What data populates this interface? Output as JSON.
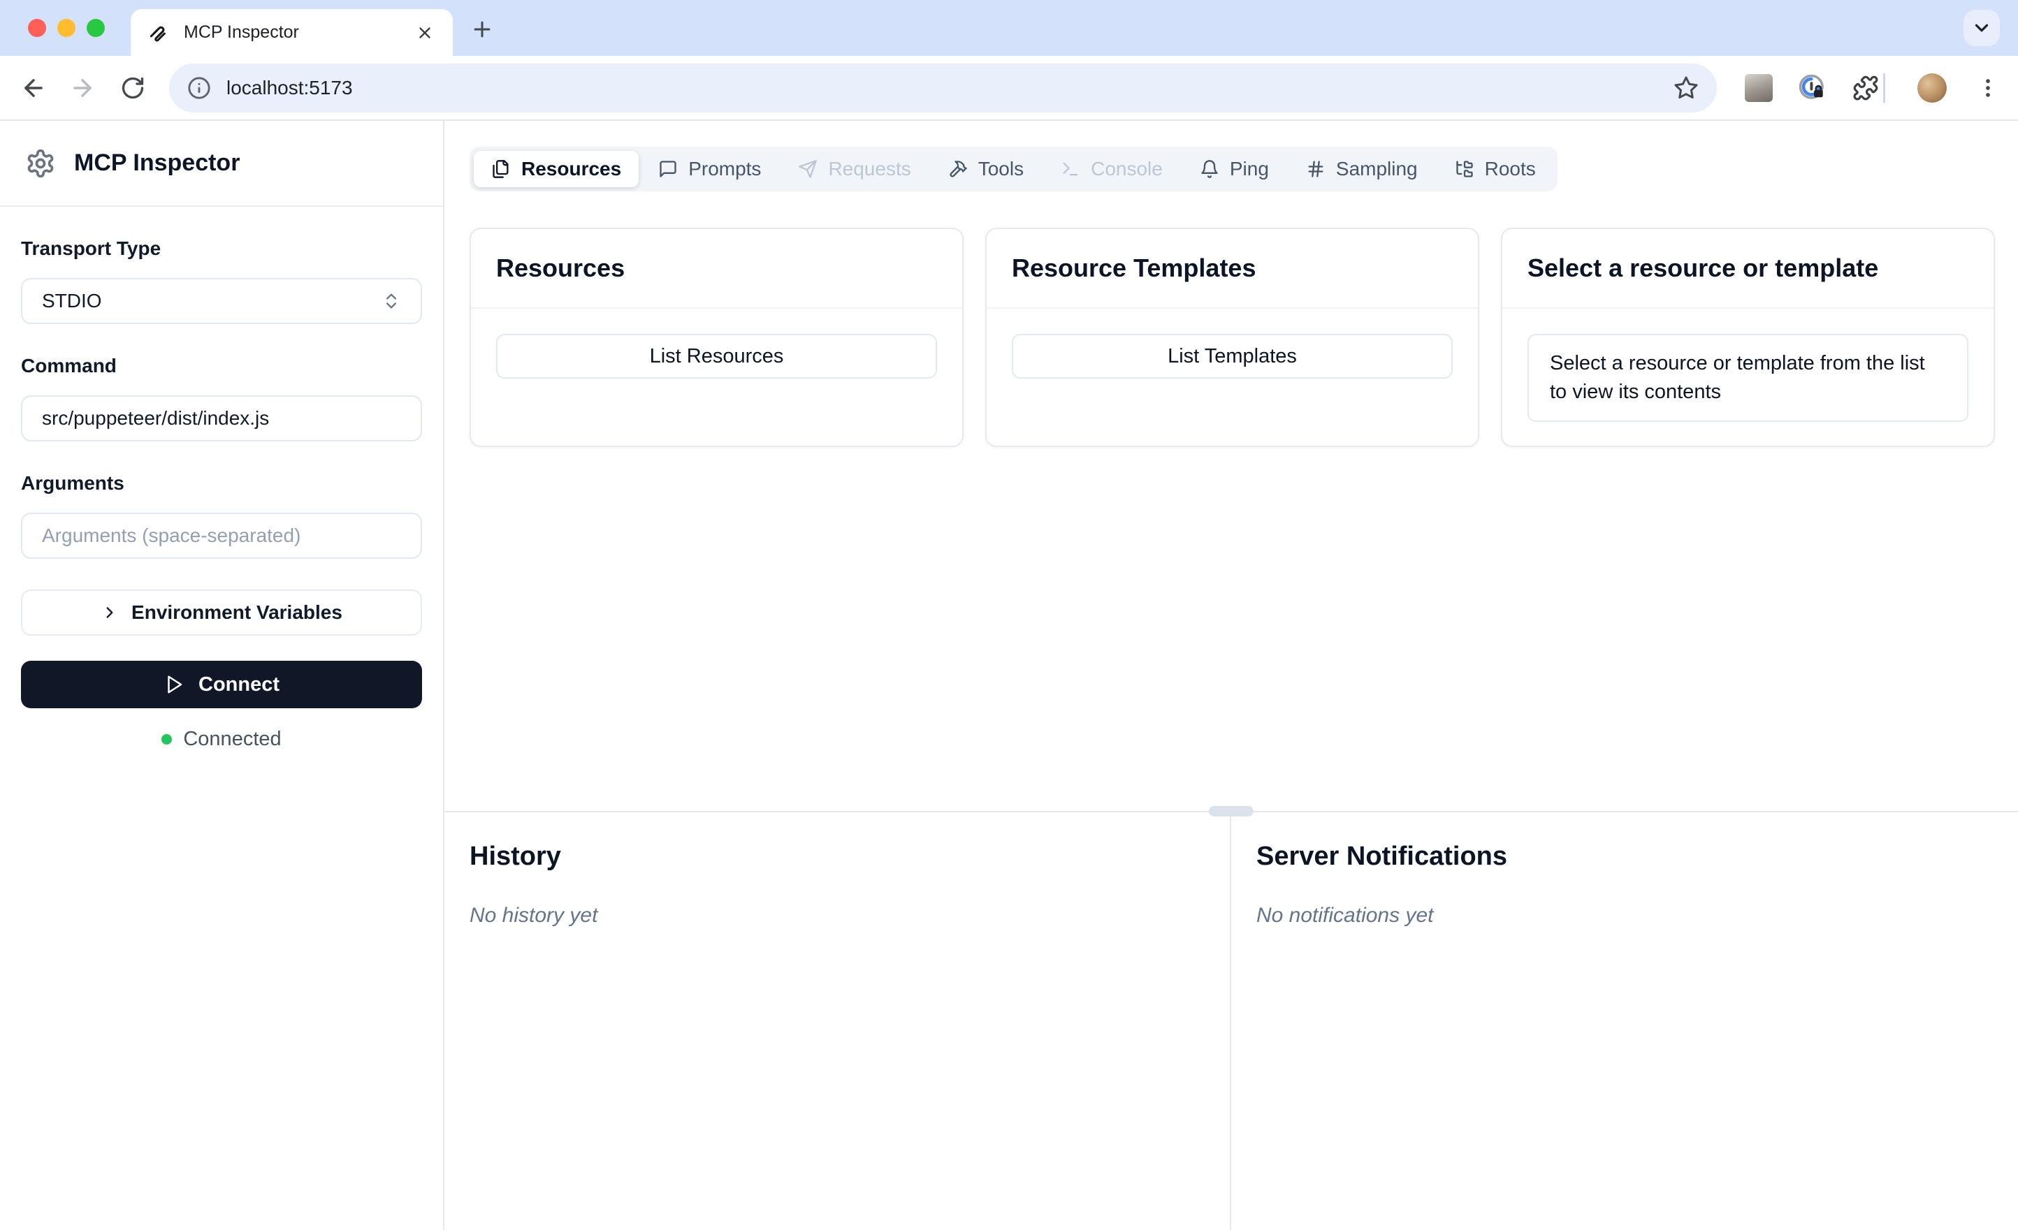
{
  "browser": {
    "tab_title": "MCP Inspector",
    "url": "localhost:5173"
  },
  "sidebar": {
    "app_title": "MCP Inspector",
    "transport": {
      "label": "Transport Type",
      "value": "STDIO"
    },
    "command": {
      "label": "Command",
      "value": "src/puppeteer/dist/index.js"
    },
    "arguments": {
      "label": "Arguments",
      "placeholder": "Arguments (space-separated)"
    },
    "env_button_label": "Environment Variables",
    "connect_button_label": "Connect",
    "status_text": "Connected"
  },
  "tabs": [
    {
      "label": "Resources",
      "icon": "files-icon",
      "state": "active"
    },
    {
      "label": "Prompts",
      "icon": "message-square-icon",
      "state": "normal"
    },
    {
      "label": "Requests",
      "icon": "send-icon",
      "state": "disabled"
    },
    {
      "label": "Tools",
      "icon": "hammer-icon",
      "state": "normal"
    },
    {
      "label": "Console",
      "icon": "terminal-icon",
      "state": "disabled"
    },
    {
      "label": "Ping",
      "icon": "bell-icon",
      "state": "normal"
    },
    {
      "label": "Sampling",
      "icon": "hash-icon",
      "state": "normal"
    },
    {
      "label": "Roots",
      "icon": "folder-tree-icon",
      "state": "normal"
    }
  ],
  "cards": {
    "resources": {
      "title": "Resources",
      "button_label": "List Resources"
    },
    "templates": {
      "title": "Resource Templates",
      "button_label": "List Templates"
    },
    "preview": {
      "title": "Select a resource or template",
      "body": "Select a resource or template from the list to view its contents"
    }
  },
  "panels": {
    "history": {
      "title": "History",
      "empty_text": "No history yet"
    },
    "notifications": {
      "title": "Server Notifications",
      "empty_text": "No notifications yet"
    }
  },
  "colors": {
    "tabstrip_bg": "#d3e1fb",
    "urlbar_bg": "#e9effb",
    "connect_bg": "#101828",
    "status_green": "#22c55e",
    "tabs_container_bg": "#f1f5f9",
    "text_dark": "#0b1526",
    "border": "#e2e8f0"
  }
}
